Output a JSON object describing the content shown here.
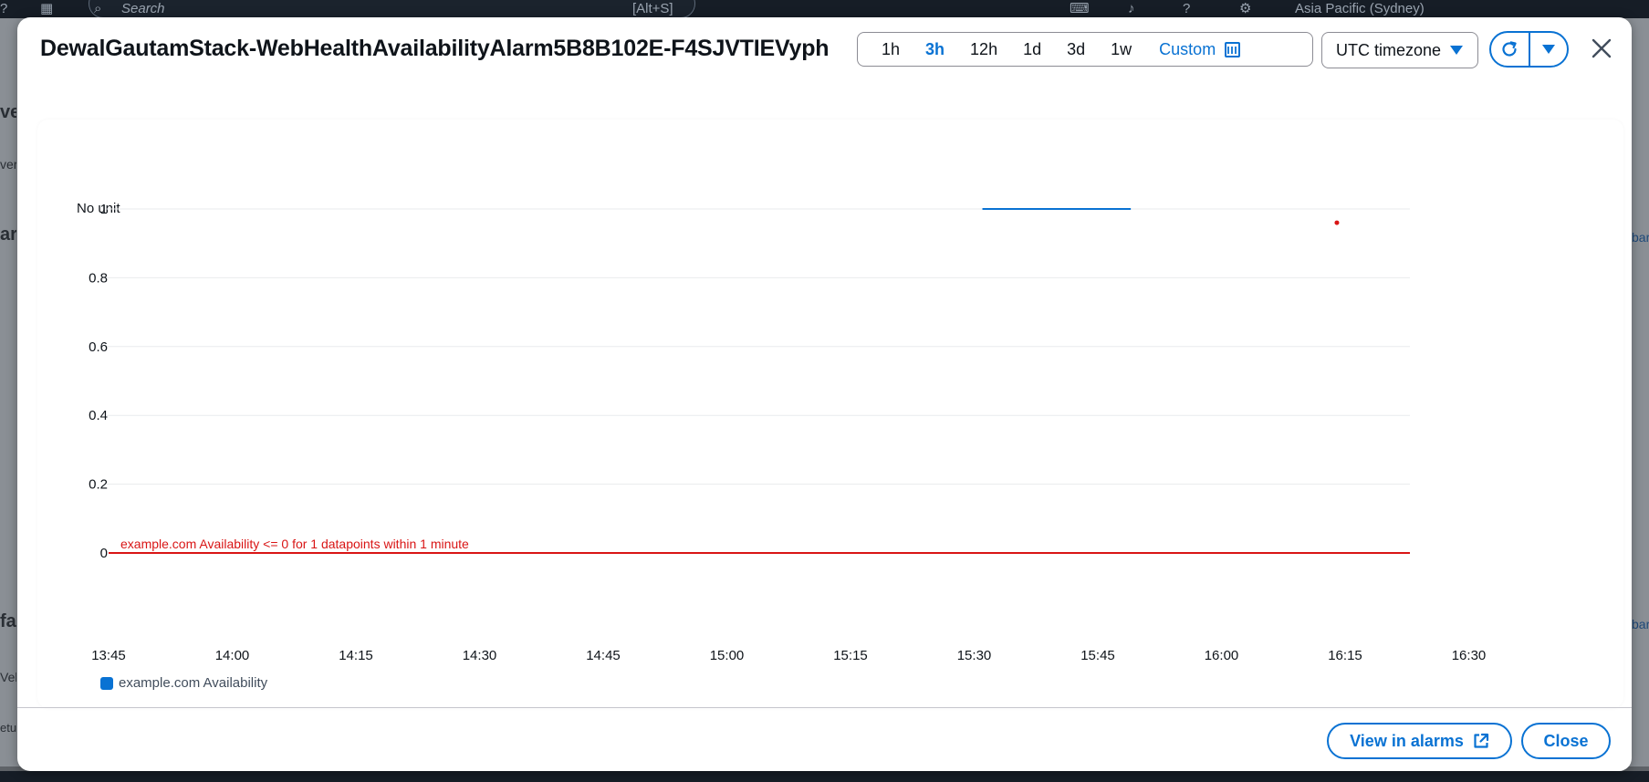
{
  "background": {
    "search_placeholder": "Search",
    "search_shortcut": "[Alt+S]",
    "region": "Asia Pacific (Sydney)",
    "left_fragments": [
      "ver",
      "ver",
      "arn",
      "fa",
      "Veb",
      "etu"
    ],
    "right_fragments": [
      "bar",
      "bar"
    ]
  },
  "modal": {
    "title": "DewalGautamStack-WebHealthAvailabilityAlarm5B8B102E-F4SJVTIEVyph",
    "time_ranges": [
      "1h",
      "3h",
      "12h",
      "1d",
      "3d",
      "1w"
    ],
    "active_range": "3h",
    "custom_label": "Custom",
    "timezone": "UTC timezone",
    "view_in_alarms": "View in alarms",
    "close": "Close"
  },
  "chart_data": {
    "type": "line",
    "unit_label": "No unit",
    "ylim": [
      0,
      1
    ],
    "y_ticks": [
      "0",
      "0.2",
      "0.4",
      "0.6",
      "0.8",
      "1"
    ],
    "x_ticks": [
      "13:45",
      "14:00",
      "14:15",
      "14:30",
      "14:45",
      "15:00",
      "15:15",
      "15:30",
      "15:45",
      "16:00",
      "16:15",
      "16:30"
    ],
    "series": [
      {
        "name": "example.com Availability",
        "color": "#0972d3",
        "points": [
          [
            "15:31",
            1
          ],
          [
            "15:49",
            1
          ]
        ]
      }
    ],
    "alarm_point": {
      "x": "16:14",
      "y": 0.96,
      "color": "#d91515"
    },
    "threshold": {
      "value": 0,
      "label": "example.com Availability <= 0 for 1 datapoints within 1 minute",
      "color": "#d91515"
    },
    "grid": true,
    "legend_position": "bottom-left"
  }
}
